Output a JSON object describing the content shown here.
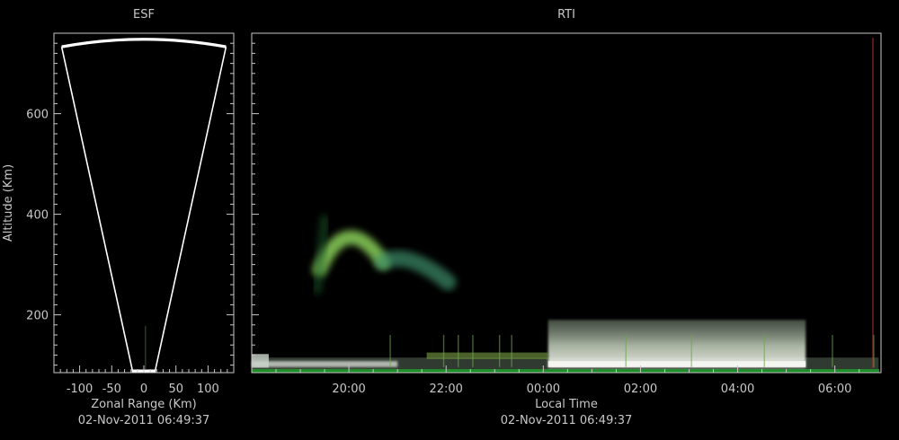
{
  "colors": {
    "background": "#000000",
    "frame": "#c8c8c8",
    "text": "#c8c8c8",
    "cone": "#ffffff",
    "right_edge_marker": "#b03030"
  },
  "chart_data": [
    {
      "type": "heatmap",
      "panel": "esf",
      "title": "ESF",
      "xlabel": "Zonal Range (Km)",
      "ylabel": "Altitude (Km)",
      "timestamp": "02-Nov-2011 06:49:37",
      "xlim": [
        -140,
        140
      ],
      "ylim": [
        85,
        760
      ],
      "x_ticks": [
        -100,
        -50,
        0,
        50,
        100
      ],
      "x_tick_labels": [
        "-100",
        "-50",
        "0",
        "50",
        "100"
      ],
      "y_ticks": [
        200,
        400,
        600
      ],
      "y_tick_labels": [
        "200",
        "400",
        "600"
      ],
      "grid": false,
      "beam_cone": {
        "apex_left": [
          -17,
          85
        ],
        "apex_right": [
          17,
          85
        ],
        "top_left": [
          -128,
          733
        ],
        "top_right": [
          128,
          733
        ],
        "arc_peak_altitude": 748
      }
    },
    {
      "type": "heatmap",
      "panel": "rti",
      "title": "RTI",
      "xlabel": "Local Time",
      "timestamp": "02-Nov-2011 06:49:37",
      "xlim": [
        18.0,
        30.95
      ],
      "ylim": [
        85,
        760
      ],
      "x_ticks": [
        20,
        22,
        24,
        26,
        28,
        30
      ],
      "x_tick_labels": [
        "20:00",
        "22:00",
        "00:00",
        "02:00",
        "04:00",
        "06:00"
      ],
      "y_ticks": [
        200,
        400,
        600
      ],
      "grid": false,
      "echo_regions": [
        {
          "name": "plume",
          "t": 19.7,
          "alt_lo": 300,
          "alt_hi": 385,
          "dt": 1.0,
          "color": "#8ad05a"
        },
        {
          "name": "plume-tail",
          "t": 21.5,
          "alt_lo": 265,
          "alt_hi": 330,
          "dt": 0.9,
          "color": "#3e8e6a"
        },
        {
          "name": "bottomside-layer",
          "t": 24.1,
          "alt_lo": 95,
          "alt_hi": 190,
          "dt": 5.3,
          "color": "#d8e0d0"
        },
        {
          "name": "low-band",
          "t": 18.0,
          "alt_lo": 88,
          "alt_hi": 115,
          "dt": 12.9,
          "color": "#5a6a58"
        }
      ]
    }
  ]
}
